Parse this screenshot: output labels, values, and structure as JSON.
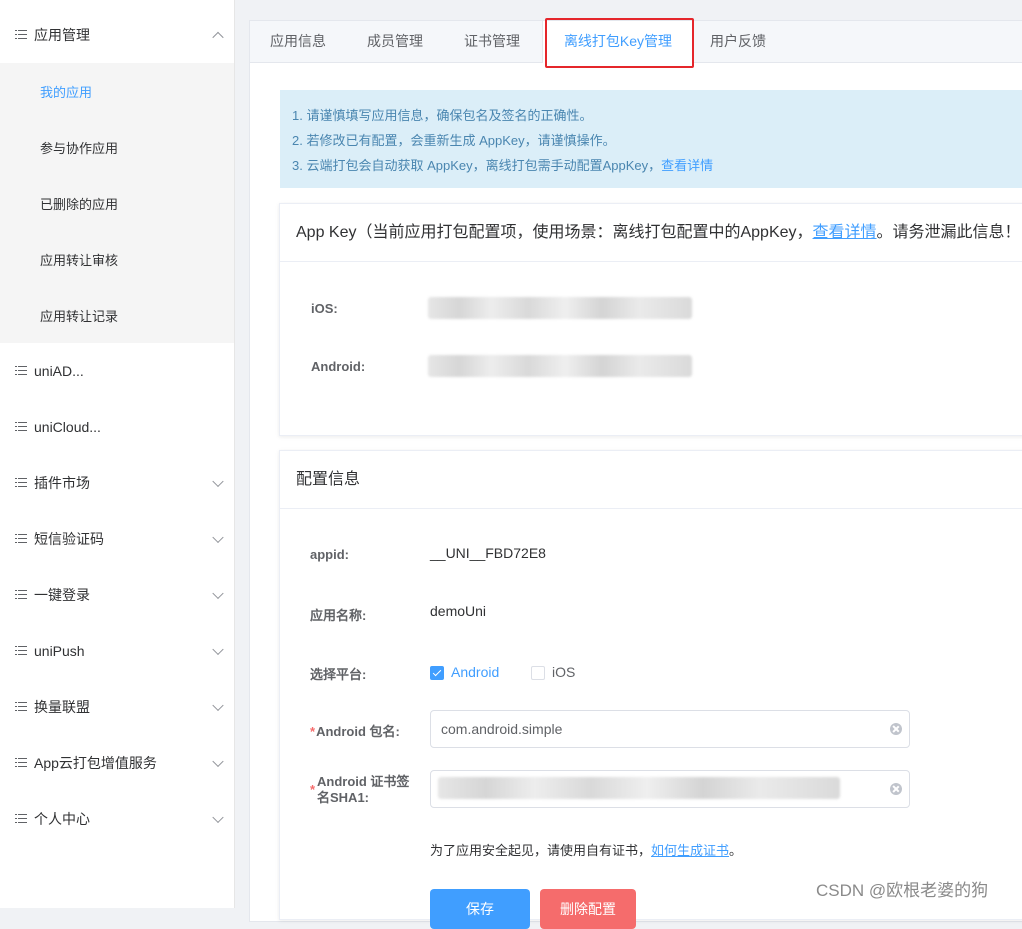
{
  "sidebar": {
    "sections": [
      {
        "label": "应用管理",
        "expanded": true
      },
      {
        "label": "uniAD..."
      },
      {
        "label": "uniCloud..."
      },
      {
        "label": "插件市场",
        "has_arrow": true
      },
      {
        "label": "短信验证码",
        "has_arrow": true
      },
      {
        "label": "一键登录",
        "has_arrow": true
      },
      {
        "label": "uniPush",
        "has_arrow": true
      },
      {
        "label": "换量联盟",
        "has_arrow": true
      },
      {
        "label": "App云打包增值服务",
        "has_arrow": true
      },
      {
        "label": "个人中心",
        "has_arrow": true
      }
    ],
    "app_submenu": [
      "我的应用",
      "参与协作应用",
      "已删除的应用",
      "应用转让审核",
      "应用转让记录"
    ],
    "active_submenu": "我的应用"
  },
  "tabs": [
    "应用信息",
    "成员管理",
    "证书管理",
    "离线打包Key管理",
    "用户反馈"
  ],
  "active_tab": "离线打包Key管理",
  "notice": {
    "line1": "1. 请谨慎填写应用信息，确保包名及签名的正确性。",
    "line2": "2. 若修改已有配置，会重新生成 AppKey，请谨慎操作。",
    "line3_prefix": "3. 云端打包会自动获取 AppKey，离线打包需手动配置AppKey，",
    "line3_link": "查看详情"
  },
  "appkey_card": {
    "title_prefix": "App Key（当前应用打包配置项，使用场景：离线打包配置中的AppKey，",
    "title_link": "查看详情",
    "title_suffix": "。请务泄漏此信息！",
    "ios_label": "iOS:",
    "android_label": "Android:"
  },
  "config_card": {
    "title": "配置信息",
    "appid_label": "appid:",
    "appid_value": "__UNI__FBD72E8",
    "app_name_label": "应用名称:",
    "app_name_value": "demoUni",
    "platform_label": "选择平台:",
    "platforms": [
      {
        "label": "Android",
        "checked": true
      },
      {
        "label": "iOS",
        "checked": false
      }
    ],
    "package_label": "Android 包名:",
    "package_value": "com.android.simple",
    "sha1_label_line1": "Android 证书签",
    "sha1_label_line2": "名SHA1:",
    "hint_prefix": "为了应用安全起见，请使用自有证书，",
    "hint_link": "如何生成证书",
    "hint_suffix": "。",
    "save_button": "保存",
    "delete_button": "删除配置"
  },
  "watermark": "CSDN @欧根老婆的狗",
  "colors": {
    "accent": "#409eff",
    "danger": "#f56c6c",
    "highlight_box": "#e5262b",
    "notice_bg": "#dbeef8"
  }
}
